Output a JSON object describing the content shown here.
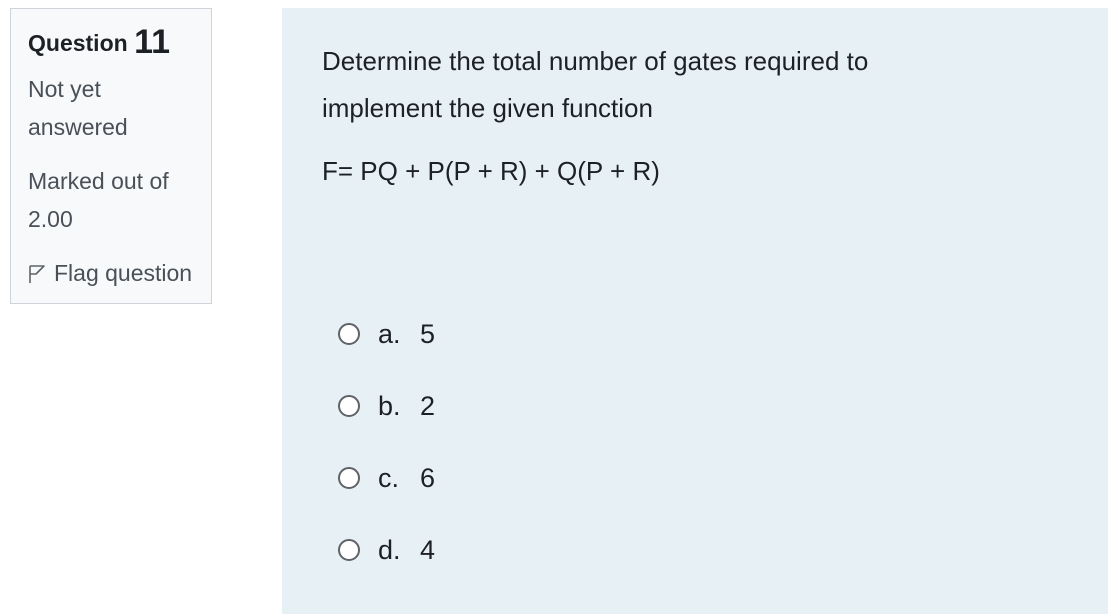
{
  "info": {
    "question_word": "Question",
    "question_number": "11",
    "state": "Not yet answered",
    "grade": "Marked out of 2.00",
    "flag_label": "Flag question"
  },
  "question": {
    "text": "Determine the total number of gates required to implement the given function",
    "formula": "F= PQ + P(P + R) + Q(P + R)"
  },
  "answers": [
    {
      "label": "a.",
      "value": "5"
    },
    {
      "label": "b.",
      "value": "2"
    },
    {
      "label": "c.",
      "value": "6"
    },
    {
      "label": "d.",
      "value": "4"
    }
  ],
  "colors": {
    "info_background": "#f8f9fa",
    "content_background": "#e7f1f5",
    "text": "#1d2125",
    "muted_text": "#495057"
  },
  "icons": {
    "flag": "flag-outline-icon",
    "radio": "radio-unchecked-icon"
  }
}
